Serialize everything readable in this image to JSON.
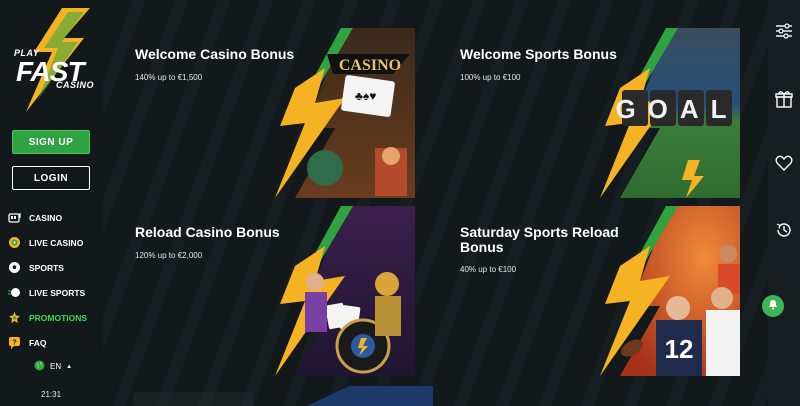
{
  "brand": {
    "logo_play": "PLAY",
    "logo_fast": "FAST",
    "logo_casino": "CASINO",
    "accent_green": "#2fa33f",
    "accent_yellow": "#f5b324"
  },
  "auth": {
    "signup_label": "SIGN UP",
    "login_label": "LOGIN"
  },
  "nav": {
    "items": [
      {
        "label": "CASINO",
        "icon": "slot-machine-icon"
      },
      {
        "label": "LIVE CASINO",
        "icon": "roulette-icon"
      },
      {
        "label": "SPORTS",
        "icon": "soccer-ball-icon"
      },
      {
        "label": "LIVE SPORTS",
        "icon": "live-ball-icon"
      },
      {
        "label": "PROMOTIONS",
        "icon": "promotions-icon",
        "active": true
      },
      {
        "label": "FAQ",
        "icon": "faq-icon"
      }
    ]
  },
  "footer": {
    "language": "EN",
    "time": "21:31"
  },
  "promos": [
    {
      "title": "Welcome Casino Bonus",
      "subtitle": "140% up to €1,500",
      "art_text": "CASINO"
    },
    {
      "title": "Welcome Sports Bonus",
      "subtitle": "100% up to €100",
      "art_text": "GOAL"
    },
    {
      "title": "Reload Casino Bonus",
      "subtitle": "120% up to €2,000"
    },
    {
      "title": "Saturday Sports Reload Bonus",
      "subtitle": "40% up to €100",
      "art_text": "12"
    }
  ],
  "rail": {
    "icons": [
      "filter-sliders-icon",
      "gift-icon",
      "heart-icon",
      "history-icon"
    ]
  }
}
